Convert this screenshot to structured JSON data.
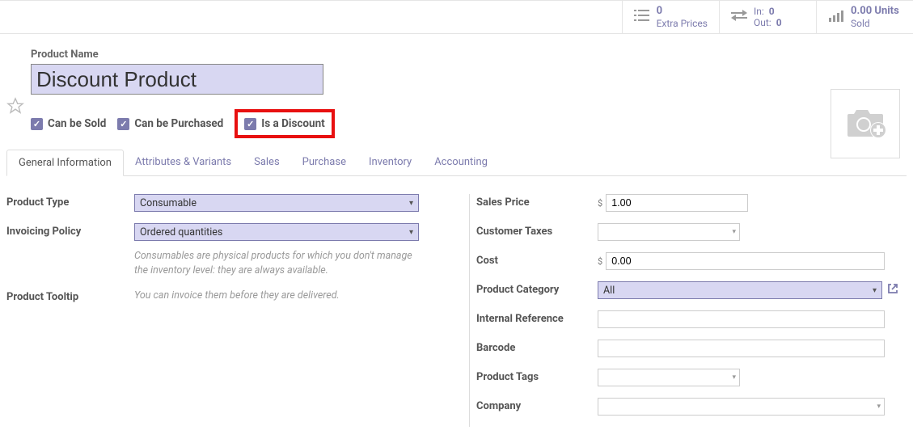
{
  "stats": {
    "extra_prices": {
      "value": "0",
      "label": "Extra Prices"
    },
    "inout": {
      "in_label": "In:",
      "in_value": "0",
      "out_label": "Out:",
      "out_value": "0"
    },
    "sold": {
      "value": "0.00 Units",
      "label": "Sold"
    }
  },
  "header": {
    "product_name_label": "Product Name",
    "product_name": "Discount Product",
    "flags": {
      "can_be_sold": "Can be Sold",
      "can_be_purchased": "Can be Purchased",
      "is_discount": "Is a Discount"
    }
  },
  "tabs": {
    "general": "General Information",
    "attributes": "Attributes & Variants",
    "sales": "Sales",
    "purchase": "Purchase",
    "inventory": "Inventory",
    "accounting": "Accounting"
  },
  "left": {
    "product_type_label": "Product Type",
    "product_type_value": "Consumable",
    "invoicing_policy_label": "Invoicing Policy",
    "invoicing_policy_value": "Ordered quantities",
    "help1": "Consumables are physical products for which you don't manage the inventory level: they are always available.",
    "product_tooltip_label": "Product Tooltip",
    "help2": "You can invoice them before they are delivered."
  },
  "right": {
    "sales_price_label": "Sales Price",
    "sales_price_value": "1.00",
    "customer_taxes_label": "Customer Taxes",
    "cost_label": "Cost",
    "cost_value": "0.00",
    "product_category_label": "Product Category",
    "product_category_value": "All",
    "internal_reference_label": "Internal Reference",
    "barcode_label": "Barcode",
    "product_tags_label": "Product Tags",
    "company_label": "Company",
    "currency": "$"
  }
}
